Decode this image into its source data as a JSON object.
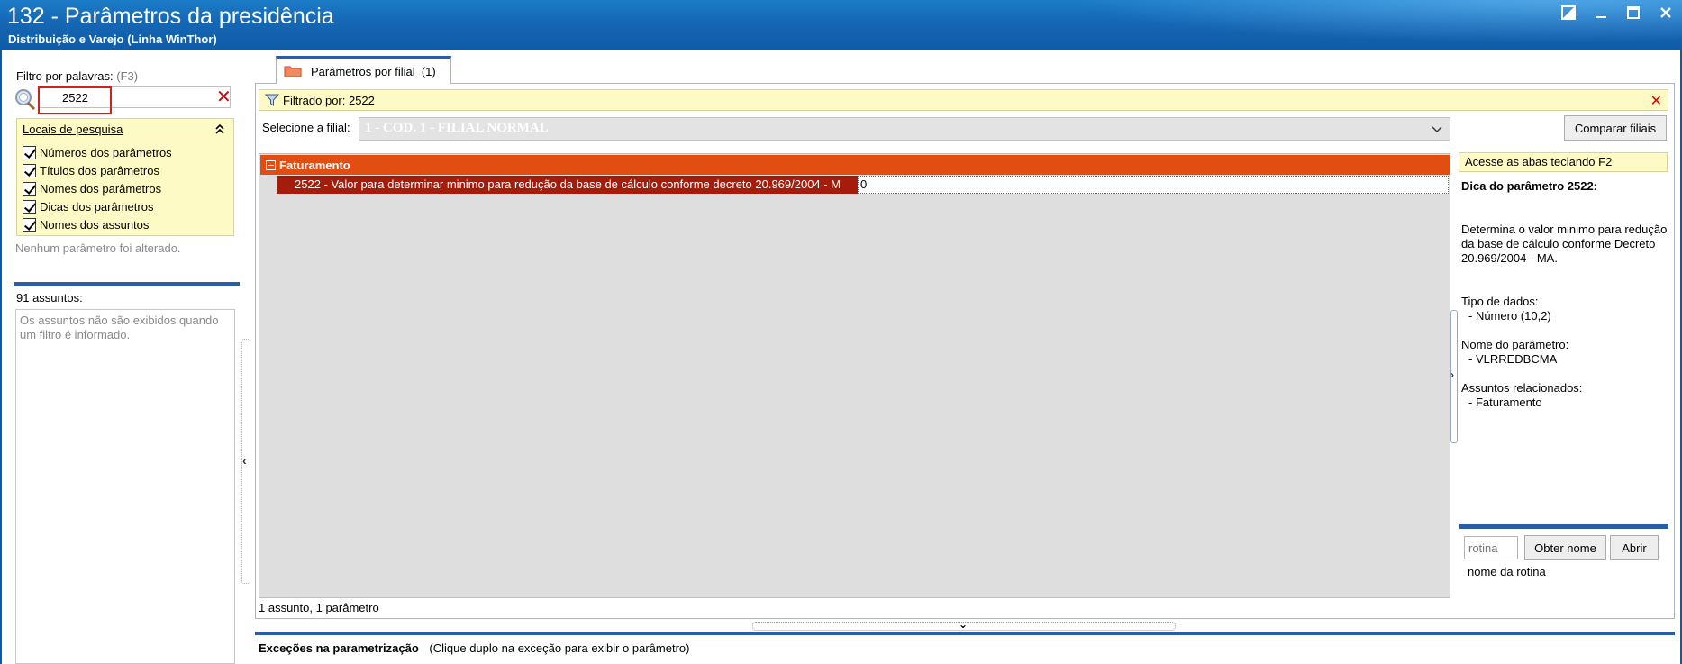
{
  "window": {
    "title": "132 - Parâmetros da presidência",
    "subtitle": "Distribuição e Varejo (Linha WinThor)"
  },
  "filter": {
    "label": "Filtro por palavras:",
    "shortcut": "(F3)",
    "value": "2522"
  },
  "locais": {
    "title": "Locais de pesquisa",
    "items": [
      {
        "label": "Números dos parâmetros",
        "checked": true
      },
      {
        "label": "Títulos dos parâmetros",
        "checked": true
      },
      {
        "label": "Nomes dos parâmetros",
        "checked": true
      },
      {
        "label": "Dicas dos parâmetros",
        "checked": true
      },
      {
        "label": "Nomes dos assuntos",
        "checked": true
      }
    ]
  },
  "no_change_text": "Nenhum parâmetro foi alterado.",
  "assuntos": {
    "label": "91 assuntos:",
    "message": "Os assuntos não são exibidos quando um filtro é informado."
  },
  "tab": {
    "label": "Parâmetros por filial",
    "count": "(1)"
  },
  "filtered": {
    "text": "Filtrado por: 2522"
  },
  "filial": {
    "label": "Selecione a filial:",
    "value": "1 - COD. 1 - FILIAL NORMAL",
    "compare_button": "Comparar filiais"
  },
  "grid": {
    "group": "Faturamento",
    "param_name": "2522 - Valor para determinar minimo para redução da base de cálculo conforme decreto 20.969/2004 - M",
    "param_value": "0"
  },
  "status": "1 assunto, 1 parâmetro",
  "tip": {
    "hint": "Acesse as abas teclando F2",
    "title": "Dica do parâmetro 2522:",
    "description": "Determina o valor minimo para redução da base de cálculo conforme Decreto 20.969/2004 - MA.",
    "data_type_label": "Tipo de dados:",
    "data_type_value": "- Número (10,2)",
    "param_name_label": "Nome do parâmetro:",
    "param_name_value": "- VLRREDBCMA",
    "related_label": "Assuntos relacionados:",
    "related_value": "- Faturamento"
  },
  "rotina": {
    "placeholder": "rotina",
    "get_name_button": "Obter nome",
    "open_button": "Abrir",
    "name_label": "nome da rotina"
  },
  "exceptions": {
    "title": "Exceções na parametrização",
    "hint": "(Clique duplo na exceção para exibir o parâmetro)"
  },
  "colors": {
    "titlebar": "#1567b4",
    "group_header": "#e24e12",
    "param_row": "#a41c0c",
    "highlight_panel": "#fdfac5",
    "accent_bar": "#2b5ca8"
  }
}
